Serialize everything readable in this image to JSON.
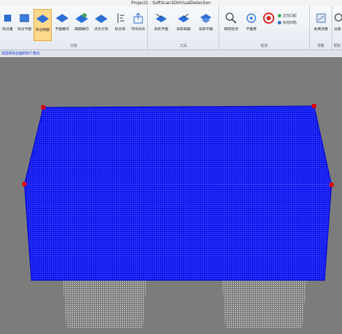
{
  "window": {
    "title": "Project1 - SoftScan3DVirtualDetection"
  },
  "ribbon": {
    "groups": [
      {
        "label": "分割"
      },
      {
        "label": "工具"
      },
      {
        "label": "检测"
      },
      {
        "label": "测量"
      },
      {
        "label": "帮助"
      }
    ],
    "buttons": {
      "b1": "拟合面",
      "b2": "拟合平面",
      "b3": "拟合曲面",
      "b4": "平面裁切",
      "b5": "曲面裁切",
      "b6": "点云分割",
      "b7": "拟合线",
      "b8": "导出点云",
      "b9": "投影平面",
      "b10": "投影曲面",
      "b11": "投影中面",
      "b12": "缺陷检测",
      "b13": "平面度",
      "b14": "距离测量",
      "b15": "设置"
    },
    "detect_options": {
      "opt1": "正向凸起",
      "opt2": "负向凹陷"
    },
    "active_button": "b3"
  },
  "hint": {
    "text": "请选择拟合面的四个角点"
  },
  "colors": {
    "accent": "#0000ff",
    "selected_point": "#e00000",
    "active_button": "#ffd98c"
  }
}
